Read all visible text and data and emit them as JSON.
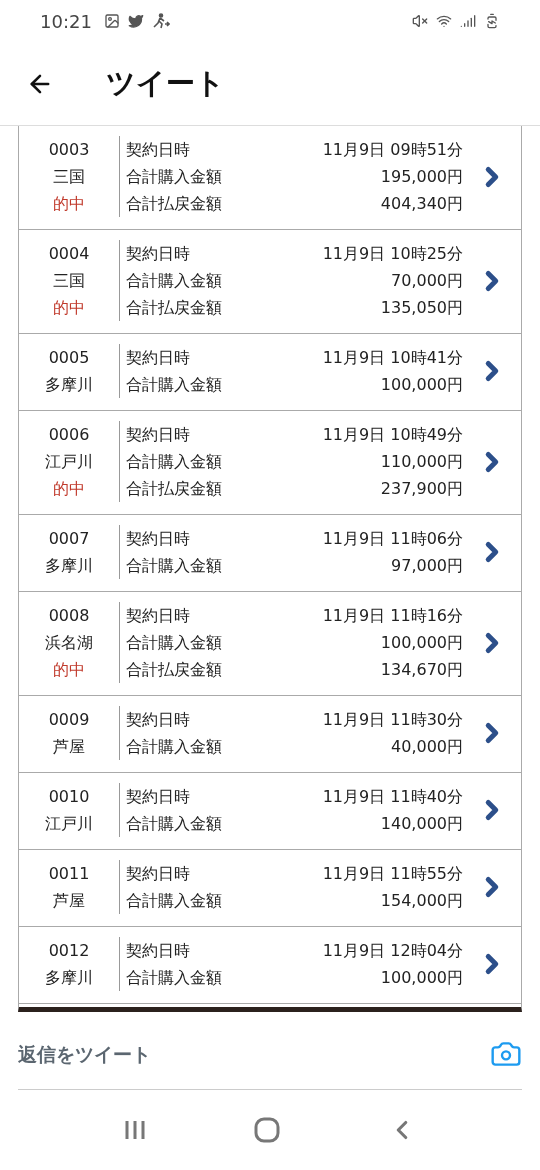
{
  "status_bar": {
    "time": "10:21"
  },
  "header": {
    "title": "ツイート"
  },
  "records": [
    {
      "number": "0003",
      "venue": "三国",
      "result": "的中",
      "details": [
        {
          "label": "契約日時",
          "value": "11月9日 09時51分"
        },
        {
          "label": "合計購入金額",
          "value": "195,000円"
        },
        {
          "label": "合計払戻金額",
          "value": "404,340円"
        }
      ]
    },
    {
      "number": "0004",
      "venue": "三国",
      "result": "的中",
      "details": [
        {
          "label": "契約日時",
          "value": "11月9日 10時25分"
        },
        {
          "label": "合計購入金額",
          "value": "70,000円"
        },
        {
          "label": "合計払戻金額",
          "value": "135,050円"
        }
      ]
    },
    {
      "number": "0005",
      "venue": "多摩川",
      "details": [
        {
          "label": "契約日時",
          "value": "11月9日 10時41分"
        },
        {
          "label": "合計購入金額",
          "value": "100,000円"
        }
      ]
    },
    {
      "number": "0006",
      "venue": "江戸川",
      "result": "的中",
      "details": [
        {
          "label": "契約日時",
          "value": "11月9日 10時49分"
        },
        {
          "label": "合計購入金額",
          "value": "110,000円"
        },
        {
          "label": "合計払戻金額",
          "value": "237,900円"
        }
      ]
    },
    {
      "number": "0007",
      "venue": "多摩川",
      "details": [
        {
          "label": "契約日時",
          "value": "11月9日 11時06分"
        },
        {
          "label": "合計購入金額",
          "value": "97,000円"
        }
      ]
    },
    {
      "number": "0008",
      "venue": "浜名湖",
      "result": "的中",
      "details": [
        {
          "label": "契約日時",
          "value": "11月9日 11時16分"
        },
        {
          "label": "合計購入金額",
          "value": "100,000円"
        },
        {
          "label": "合計払戻金額",
          "value": "134,670円"
        }
      ]
    },
    {
      "number": "0009",
      "venue": "芦屋",
      "details": [
        {
          "label": "契約日時",
          "value": "11月9日 11時30分"
        },
        {
          "label": "合計購入金額",
          "value": "40,000円"
        }
      ]
    },
    {
      "number": "0010",
      "venue": "江戸川",
      "details": [
        {
          "label": "契約日時",
          "value": "11月9日 11時40分"
        },
        {
          "label": "合計購入金額",
          "value": "140,000円"
        }
      ]
    },
    {
      "number": "0011",
      "venue": "芦屋",
      "details": [
        {
          "label": "契約日時",
          "value": "11月9日 11時55分"
        },
        {
          "label": "合計購入金額",
          "value": "154,000円"
        }
      ]
    },
    {
      "number": "0012",
      "venue": "多摩川",
      "details": [
        {
          "label": "契約日時",
          "value": "11月9日 12時04分"
        },
        {
          "label": "合計購入金額",
          "value": "100,000円"
        }
      ]
    }
  ],
  "reply_bar": {
    "placeholder": "返信をツイート"
  }
}
